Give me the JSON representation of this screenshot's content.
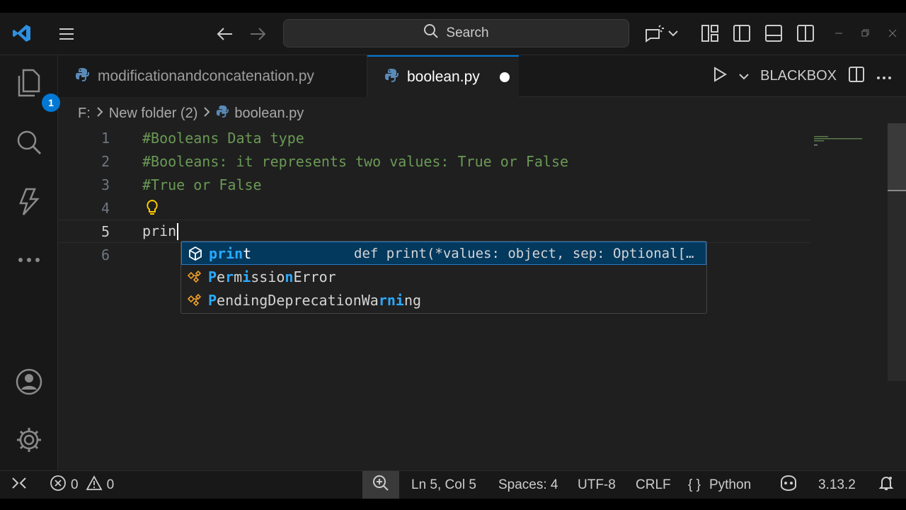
{
  "titlebar": {
    "search_label": "Search",
    "icons": [
      "vscode-logo-icon",
      "menu-icon",
      "back-arrow-icon",
      "forward-arrow-icon",
      "copilot-icon",
      "layout-icon",
      "toggle-sidebar-icon",
      "toggle-panel-icon",
      "toggle-secondary-sidebar-icon",
      "minimize-icon",
      "restore-icon",
      "close-icon"
    ]
  },
  "activitybar": {
    "explorer_badge": "1",
    "icons": [
      "explorer-icon",
      "search-icon",
      "testing-icon",
      "more-icon",
      "accounts-icon",
      "settings-gear-icon"
    ]
  },
  "tabs": [
    {
      "label": "modificationandconcatenation.py",
      "active": false
    },
    {
      "label": "boolean.py",
      "active": true,
      "dirty": true
    }
  ],
  "tab_actions": {
    "blackbox_label": "BLACKBOX"
  },
  "breadcrumb": {
    "drive": "F:",
    "folder": "New folder (2)",
    "file": "boolean.py"
  },
  "editor": {
    "lines": [
      {
        "num": "1",
        "text": "#Booleans Data type",
        "kind": "comment"
      },
      {
        "num": "2",
        "text": "#Booleans: it represents two values: True or False",
        "kind": "comment"
      },
      {
        "num": "3",
        "text": "#True or False",
        "kind": "comment"
      },
      {
        "num": "4",
        "text": "",
        "kind": "plain"
      },
      {
        "num": "5",
        "text": "prin",
        "kind": "plain"
      },
      {
        "num": "6",
        "text": "",
        "kind": "plain"
      }
    ],
    "current_line": 5
  },
  "suggestions": [
    {
      "label": "print",
      "detail": "def print(*values: object, sep: Optional[…",
      "selected": true,
      "icon": "method-cube-icon"
    },
    {
      "label": "PermissionError",
      "detail": "",
      "selected": false,
      "icon": "class-icon"
    },
    {
      "label": "PendingDeprecationWarning",
      "detail": "",
      "selected": false,
      "icon": "class-icon"
    }
  ],
  "statusbar": {
    "errors": "0",
    "warnings": "0",
    "position": "Ln 5, Col 5",
    "spaces": "Spaces: 4",
    "encoding": "UTF-8",
    "eol": "CRLF",
    "language": "Python",
    "python_version": "3.13.2"
  },
  "colors": {
    "accent": "#0078d4",
    "comment": "#6a9955",
    "match_highlight": "#2aaaff"
  }
}
